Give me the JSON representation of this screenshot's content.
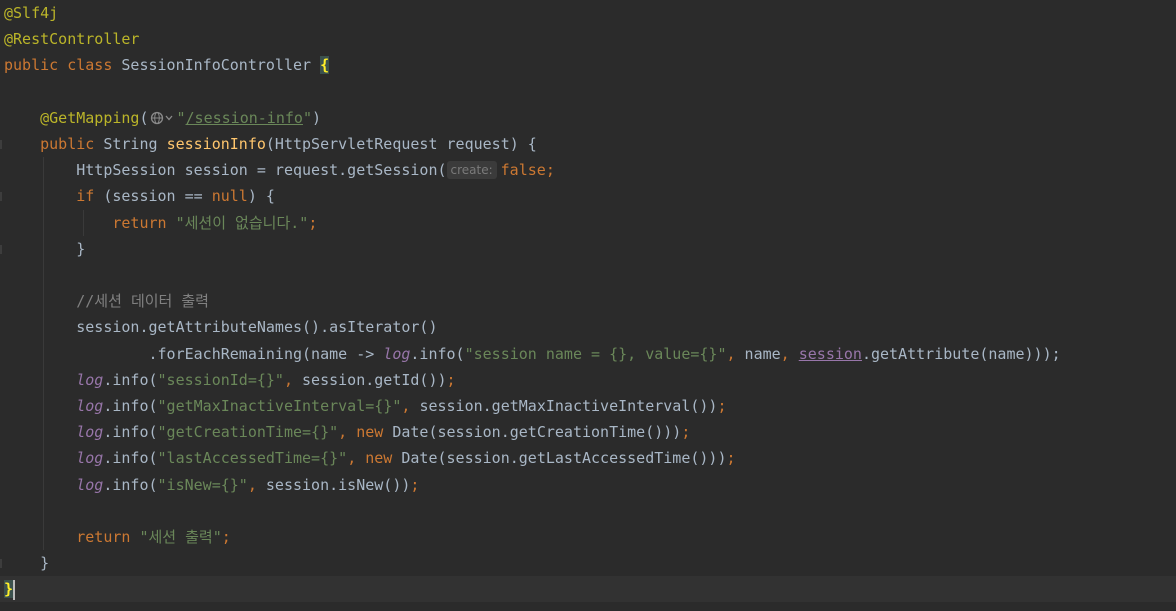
{
  "editor": {
    "lines": [
      {
        "t": [
          {
            "c": "ann",
            "v": "@Slf4j"
          }
        ]
      },
      {
        "t": [
          {
            "c": "ann",
            "v": "@RestController"
          }
        ]
      },
      {
        "t": [
          {
            "c": "kw",
            "v": "public class "
          },
          {
            "c": "pl",
            "v": "SessionInfoController "
          },
          {
            "c": "brace-hl",
            "v": "{"
          }
        ]
      },
      {
        "t": []
      },
      {
        "t": [
          {
            "c": "pl",
            "v": "    "
          },
          {
            "c": "ann",
            "v": "@GetMapping"
          },
          {
            "c": "pl",
            "v": "("
          },
          {
            "c": "globe",
            "v": ""
          },
          {
            "c": "str",
            "v": "\""
          },
          {
            "c": "lnk",
            "v": "/session-info"
          },
          {
            "c": "str",
            "v": "\""
          },
          {
            "c": "pl",
            "v": ")"
          }
        ]
      },
      {
        "t": [
          {
            "c": "kw",
            "v": "    public "
          },
          {
            "c": "pl",
            "v": "String "
          },
          {
            "c": "fn",
            "v": "sessionInfo"
          },
          {
            "c": "pl",
            "v": "(HttpServletRequest request) {"
          }
        ]
      },
      {
        "t": [
          {
            "c": "pl",
            "v": "        HttpSession session = request.getSession("
          },
          {
            "c": "hint",
            "v": "create:"
          },
          {
            "c": "kw",
            "v": "false"
          },
          {
            "c": "kw",
            "v": ";"
          }
        ]
      },
      {
        "t": [
          {
            "c": "kw",
            "v": "        if "
          },
          {
            "c": "pl",
            "v": "(session == "
          },
          {
            "c": "kw",
            "v": "null"
          },
          {
            "c": "pl",
            "v": ") {"
          }
        ]
      },
      {
        "t": [
          {
            "c": "kw",
            "v": "            return "
          },
          {
            "c": "str",
            "v": "\"세션이 없습니다.\""
          },
          {
            "c": "kw",
            "v": ";"
          }
        ]
      },
      {
        "t": [
          {
            "c": "pl",
            "v": "        }"
          }
        ]
      },
      {
        "t": []
      },
      {
        "t": [
          {
            "c": "cmt",
            "v": "        //세션 데이터 출력"
          }
        ]
      },
      {
        "t": [
          {
            "c": "pl",
            "v": "        session.getAttributeNames().asIterator()"
          }
        ]
      },
      {
        "t": [
          {
            "c": "pl",
            "v": "                .forEachRemaining(name -> "
          },
          {
            "c": "log",
            "v": "log"
          },
          {
            "c": "pl",
            "v": ".info("
          },
          {
            "c": "str",
            "v": "\"session name = {}, value={}\""
          },
          {
            "c": "kw",
            "v": ", "
          },
          {
            "c": "pl",
            "v": "name"
          },
          {
            "c": "kw",
            "v": ", "
          },
          {
            "c": "fld",
            "v": "session"
          },
          {
            "c": "pl",
            "v": ".getAttribute(name)));"
          }
        ]
      },
      {
        "t": [
          {
            "c": "log",
            "v": "        log"
          },
          {
            "c": "pl",
            "v": ".info("
          },
          {
            "c": "str",
            "v": "\"sessionId={}\""
          },
          {
            "c": "kw",
            "v": ", "
          },
          {
            "c": "pl",
            "v": "session.getId())"
          },
          {
            "c": "kw",
            "v": ";"
          }
        ]
      },
      {
        "t": [
          {
            "c": "log",
            "v": "        log"
          },
          {
            "c": "pl",
            "v": ".info("
          },
          {
            "c": "str",
            "v": "\"getMaxInactiveInterval={}\""
          },
          {
            "c": "kw",
            "v": ", "
          },
          {
            "c": "pl",
            "v": "session.getMaxInactiveInterval())"
          },
          {
            "c": "kw",
            "v": ";"
          }
        ]
      },
      {
        "t": [
          {
            "c": "log",
            "v": "        log"
          },
          {
            "c": "pl",
            "v": ".info("
          },
          {
            "c": "str",
            "v": "\"getCreationTime={}\""
          },
          {
            "c": "kw",
            "v": ", new "
          },
          {
            "c": "pl",
            "v": "Date(session.getCreationTime()))"
          },
          {
            "c": "kw",
            "v": ";"
          }
        ]
      },
      {
        "t": [
          {
            "c": "log",
            "v": "        log"
          },
          {
            "c": "pl",
            "v": ".info("
          },
          {
            "c": "str",
            "v": "\"lastAccessedTime={}\""
          },
          {
            "c": "kw",
            "v": ", new "
          },
          {
            "c": "pl",
            "v": "Date(session.getLastAccessedTime()))"
          },
          {
            "c": "kw",
            "v": ";"
          }
        ]
      },
      {
        "t": [
          {
            "c": "log",
            "v": "        log"
          },
          {
            "c": "pl",
            "v": ".info("
          },
          {
            "c": "str",
            "v": "\"isNew={}\""
          },
          {
            "c": "kw",
            "v": ", "
          },
          {
            "c": "pl",
            "v": "session.isNew())"
          },
          {
            "c": "kw",
            "v": ";"
          }
        ]
      },
      {
        "t": []
      },
      {
        "t": [
          {
            "c": "kw",
            "v": "        return "
          },
          {
            "c": "str",
            "v": "\"세션 출력\""
          },
          {
            "c": "kw",
            "v": ";"
          }
        ]
      },
      {
        "t": [
          {
            "c": "pl",
            "v": "    }"
          }
        ]
      },
      {
        "t": [
          {
            "c": "brace-hl",
            "v": "}"
          }
        ],
        "current": true
      }
    ]
  },
  "colors": {
    "background": "#2b2b2b",
    "keyword": "#cc7832",
    "annotation": "#bbb529",
    "string": "#6a8759",
    "method": "#ffc66d",
    "field": "#9876aa",
    "comment": "#808080",
    "text": "#a9b7c6"
  },
  "icons": {
    "url_mapping": "globe-icon",
    "url_mapping_menu": "chevron-down-icon"
  }
}
